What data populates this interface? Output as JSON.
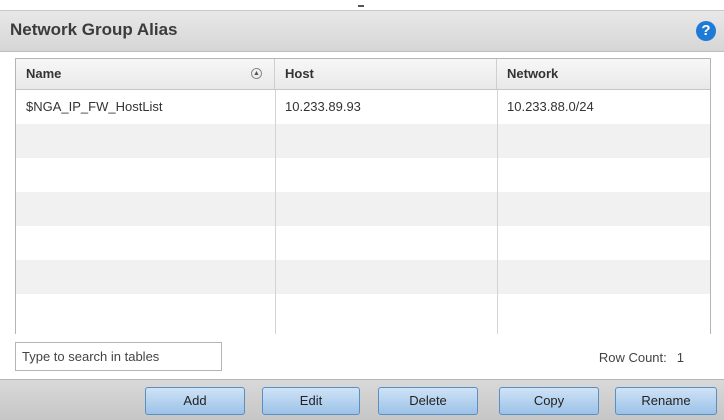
{
  "panel": {
    "title": "Network Group Alias",
    "help_icon": "question-circle-icon"
  },
  "table": {
    "columns": [
      "Name",
      "Host",
      "Network"
    ],
    "rows": [
      {
        "name": "$NGA_IP_FW_HostList",
        "host": "10.233.89.93",
        "network": "10.233.88.0/24"
      }
    ],
    "sort_icon": "sort-ascending-icon"
  },
  "footer": {
    "search_placeholder": "Type to search in tables",
    "row_count_label": "Row Count:",
    "row_count_value": "1"
  },
  "buttons": {
    "add": "Add",
    "edit": "Edit",
    "delete": "Delete",
    "copy": "Copy",
    "rename": "Rename"
  },
  "colors": {
    "accent": "#1f7ad6",
    "button_fill": "#9cc2e8"
  }
}
